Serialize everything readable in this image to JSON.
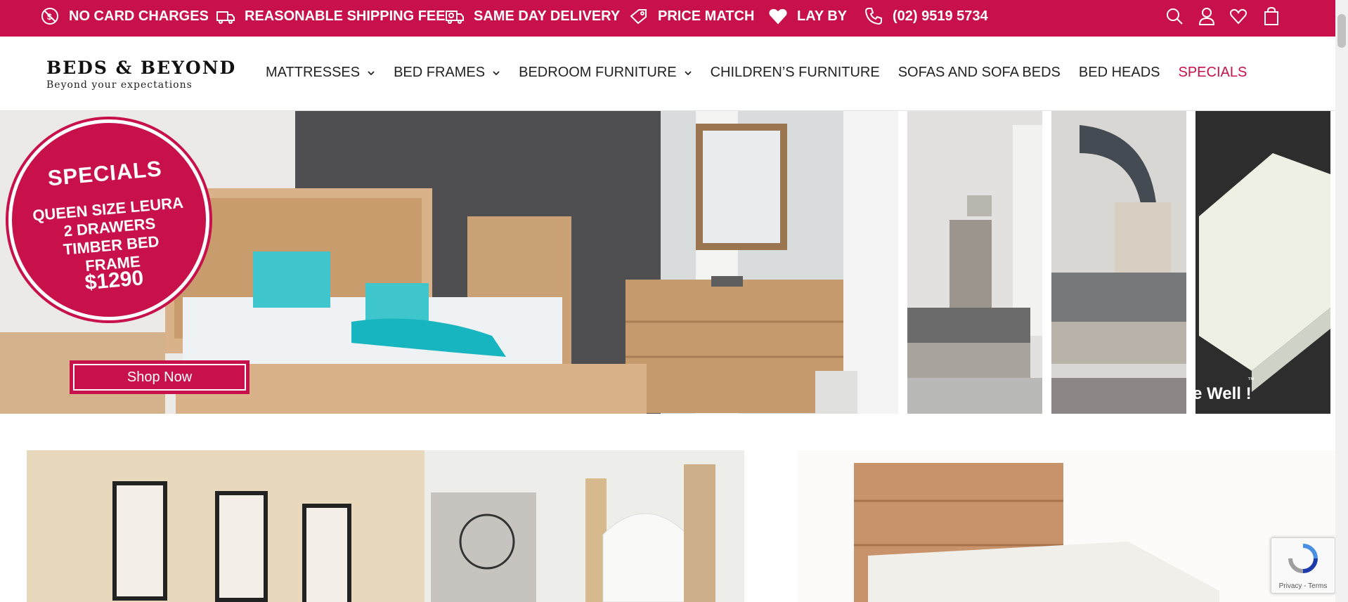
{
  "topbar": {
    "items": [
      {
        "label": "NO CARD CHARGES",
        "icon": "no-card-charges-icon"
      },
      {
        "label": "REASONABLE SHIPPING FEE",
        "icon": "shipping-truck-icon"
      },
      {
        "label": "SAME DAY DELIVERY",
        "icon": "delivery-truck-icon"
      },
      {
        "label": "PRICE MATCH",
        "icon": "price-tag-icon"
      },
      {
        "label": "LAY BY",
        "icon": "heart-hand-icon"
      },
      {
        "label": "(02) 9519 5734",
        "icon": "phone-icon"
      }
    ],
    "actions": [
      "search-icon",
      "account-icon",
      "wishlist-icon",
      "cart-icon"
    ]
  },
  "header": {
    "logo_title": "BEDS & BEYOND",
    "logo_tagline": "Beyond your expectations",
    "nav": [
      {
        "label": "MATTRESSES",
        "has_dropdown": true
      },
      {
        "label": "BED FRAMES",
        "has_dropdown": true
      },
      {
        "label": "BEDROOM FURNITURE",
        "has_dropdown": true
      },
      {
        "label": "CHILDREN’S FURNITURE",
        "has_dropdown": false
      },
      {
        "label": "SOFAS AND SOFA BEDS",
        "has_dropdown": false
      },
      {
        "label": "BED HEADS",
        "has_dropdown": false
      },
      {
        "label": "SPECIALS",
        "has_dropdown": false
      }
    ]
  },
  "hero": {
    "badge_title": "SPECIALS",
    "badge_description": "QUEEN SIZE LEURA 2 DRAWERS TIMBER BED FRAME",
    "badge_price": "$1290",
    "button_label": "Shop Now",
    "thumb_caption": "e Well !",
    "thumb_caption_mark": "™"
  },
  "recaptcha": {
    "text": "Privacy - Terms"
  },
  "colors": {
    "brand": "#c8104a",
    "text": "#222222"
  }
}
